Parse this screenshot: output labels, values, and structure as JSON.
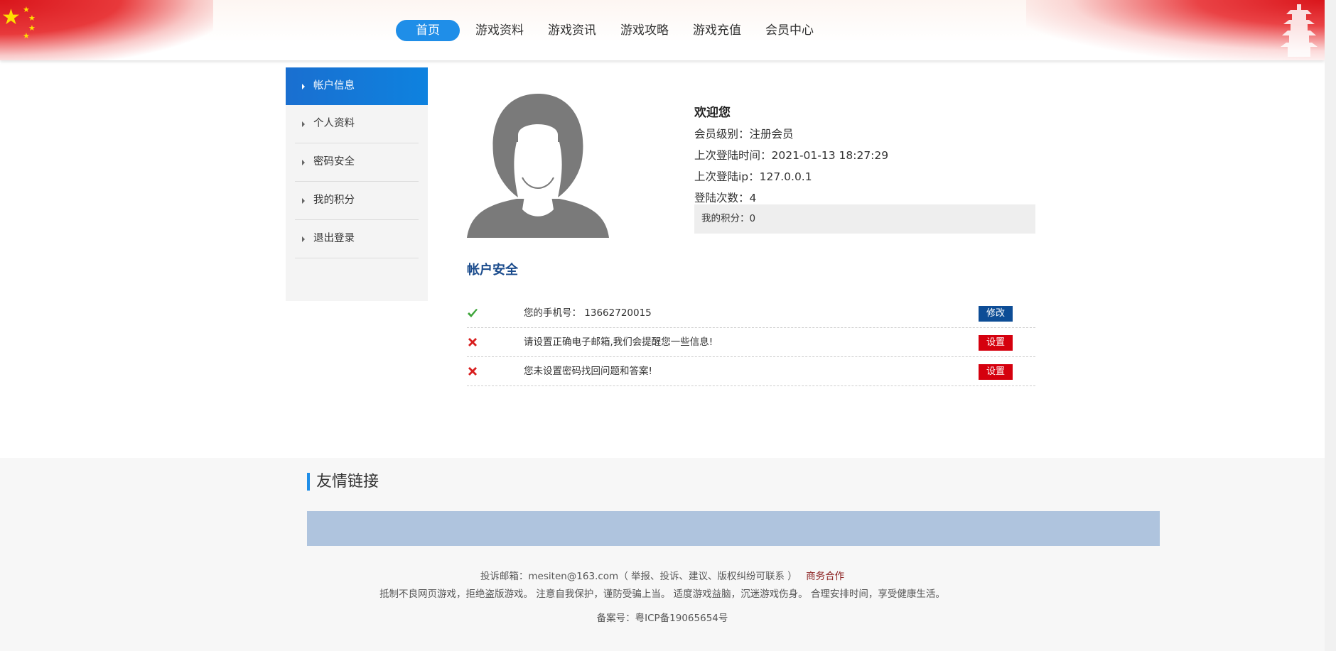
{
  "nav": {
    "items": [
      {
        "label": "首页",
        "active": true
      },
      {
        "label": "游戏资料"
      },
      {
        "label": "游戏资讯"
      },
      {
        "label": "游戏攻略"
      },
      {
        "label": "游戏充值"
      },
      {
        "label": "会员中心"
      }
    ]
  },
  "sidebar": {
    "items": [
      {
        "label": "帐户信息",
        "active": true
      },
      {
        "label": "个人资料"
      },
      {
        "label": "密码安全"
      },
      {
        "label": "我的积分"
      },
      {
        "label": "退出登录"
      }
    ]
  },
  "profile": {
    "welcome": "欢迎您",
    "level": "会员级别：注册会员",
    "last_login_time": "上次登陆时间：2021-01-13 18:27:29",
    "last_login_ip": "上次登陆ip：127.0.0.1",
    "login_count": "登陆次数：4",
    "points": "我的积分：0"
  },
  "security": {
    "title": "帐户安全",
    "rows": [
      {
        "status": "ok",
        "text": "您的手机号： 13662720015",
        "button": "修改",
        "button_style": "blue"
      },
      {
        "status": "error",
        "text": "请设置正确电子邮箱,我们会提醒您一些信息!",
        "button": "设置",
        "button_style": "red"
      },
      {
        "status": "error",
        "text": "您未设置密码找回问题和答案!",
        "button": "设置",
        "button_style": "red"
      }
    ]
  },
  "footer": {
    "links_title": "友情链接",
    "complaint": "投诉邮箱：mesiten@163.com（ 举报、投诉、建议、版权纠纷可联系 ）",
    "business": "商务合作",
    "notice": "抵制不良网页游戏，拒绝盗版游戏。 注意自我保护，谨防受骗上当。 适度游戏益脑，沉迷游戏伤身。 合理安排时间，享受健康生活。",
    "icp": "备案号：粤ICP备19065654号"
  },
  "colors": {
    "accent": "#1f8ee8",
    "sidebar_active": "#0e82df",
    "security_title": "#1a4b8c",
    "btn_blue": "#0d4d96",
    "btn_red": "#d5000e",
    "links_bar": "#afc4de"
  }
}
